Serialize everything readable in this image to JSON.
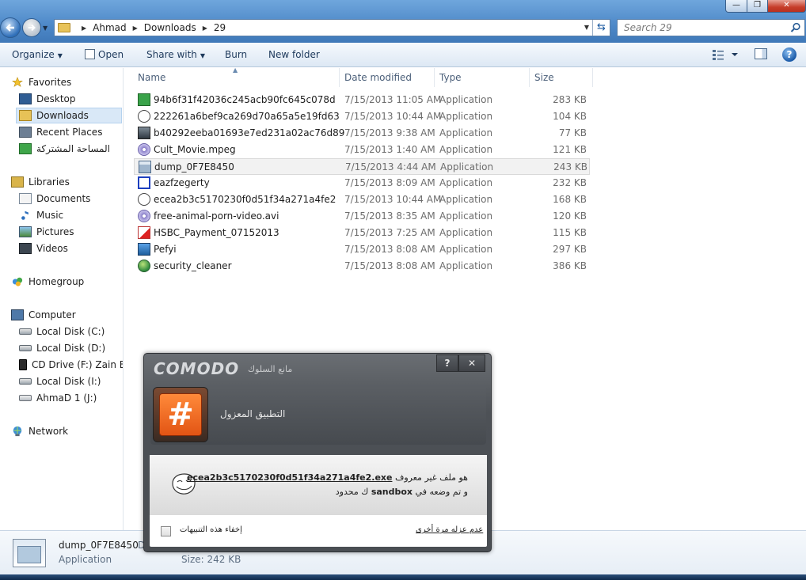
{
  "window": {
    "minimize": "—",
    "maximize": "❐",
    "close": "✕"
  },
  "address": {
    "crumbs": [
      "Ahmad",
      "Downloads",
      "29"
    ]
  },
  "search": {
    "placeholder": "Search 29"
  },
  "toolbar": {
    "organize": "Organize",
    "open": "Open",
    "share_with": "Share with",
    "burn": "Burn",
    "new_folder": "New folder"
  },
  "nav": {
    "favorites": "Favorites",
    "desktop": "Desktop",
    "downloads": "Downloads",
    "recent_places": "Recent Places",
    "shared_ar": "المساحة المشتركة",
    "libraries": "Libraries",
    "documents": "Documents",
    "music": "Music",
    "pictures": "Pictures",
    "videos": "Videos",
    "homegroup": "Homegroup",
    "computer": "Computer",
    "local_c": "Local Disk (C:)",
    "local_d": "Local Disk (D:)",
    "cd_drive": "CD Drive (F:) Zain Br",
    "local_i": "Local Disk (I:)",
    "ahmad_j": "AhmaD 1 (J:)",
    "network": "Network"
  },
  "columns": {
    "name": "Name",
    "date": "Date modified",
    "type": "Type",
    "size": "Size"
  },
  "files": [
    {
      "name": "94b6f31f42036c245acb90fc645c078d",
      "date": "7/15/2013 11:05 AM",
      "type": "Application",
      "size": "283 KB",
      "icon": "green-app-icon"
    },
    {
      "name": "222261a6bef9ca269d70a65a5e19fd63",
      "date": "7/15/2013 10:44 AM",
      "type": "Application",
      "size": "104 KB",
      "icon": "trollface-icon"
    },
    {
      "name": "b40292eeba01693e7ed231a02ac76d89",
      "date": "7/15/2013 9:38 AM",
      "type": "Application",
      "size": "77 KB",
      "icon": "photo-app-icon"
    },
    {
      "name": "Cult_Movie.mpeg",
      "date": "7/15/2013 1:40 AM",
      "type": "Application",
      "size": "121 KB",
      "icon": "media-disc-icon"
    },
    {
      "name": "dump_0F7E8450",
      "date": "7/15/2013 4:44 AM",
      "type": "Application",
      "size": "243 KB",
      "icon": "window-app-icon"
    },
    {
      "name": "eazfzegerty",
      "date": "7/15/2013 8:09 AM",
      "type": "Application",
      "size": "232 KB",
      "icon": "blue-x-icon"
    },
    {
      "name": "ecea2b3c5170230f0d51f34a271a4fe2",
      "date": "7/15/2013 10:44 AM",
      "type": "Application",
      "size": "168 KB",
      "icon": "trollface-icon"
    },
    {
      "name": "free-animal-porn-video.avi",
      "date": "7/15/2013 8:35 AM",
      "type": "Application",
      "size": "120 KB",
      "icon": "media-disc-icon"
    },
    {
      "name": "HSBC_Payment_07152013",
      "date": "7/15/2013 7:25 AM",
      "type": "Application",
      "size": "115 KB",
      "icon": "pdf-icon"
    },
    {
      "name": "Pefyi",
      "date": "7/15/2013 8:08 AM",
      "type": "Application",
      "size": "297 KB",
      "icon": "installer-icon"
    },
    {
      "name": "security_cleaner",
      "date": "7/15/2013 8:08 AM",
      "type": "Application",
      "size": "386 KB",
      "icon": "globe-shield-icon"
    }
  ],
  "details": {
    "name": "dump_0F7E8450",
    "extra": "D",
    "type": "Application",
    "size_label": "Size:",
    "size_value": "242 KB"
  },
  "comodo": {
    "logo": "COMODO",
    "subtitle": "مانع السلوك",
    "help": "?",
    "close": "✕",
    "title": "التطبيق المعزول",
    "msg_prefix": "هو ملف غير معروف",
    "filename": "ecea2b3c5170230f0d51f34a271a4fe2.exe",
    "msg2_a": "و تم وضعه في",
    "msg2_sandbox": "sandbox",
    "msg2_b": "ك محدود",
    "unsandbox_link": "عدم عزله مرة أخرى",
    "hide_alerts": "إخفاء هذه التنبيهات"
  }
}
